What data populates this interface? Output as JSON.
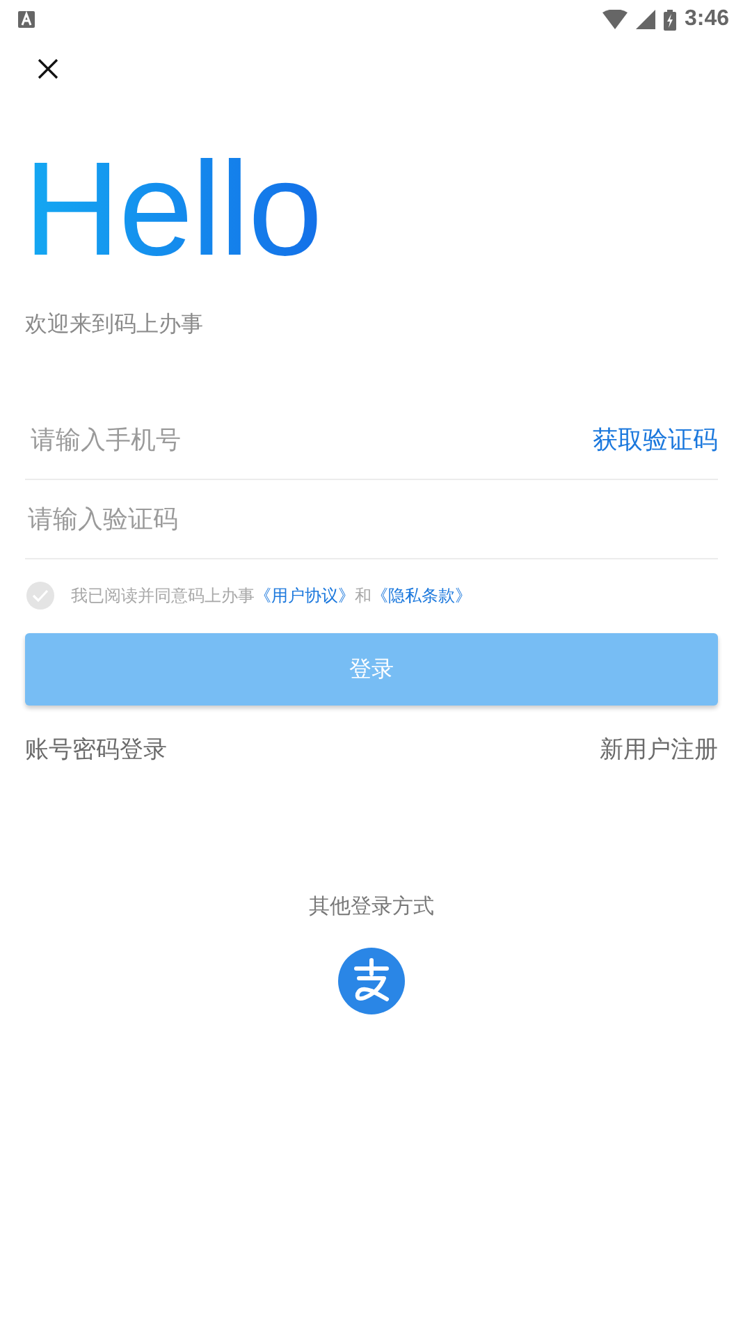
{
  "status_bar": {
    "time": "3:46"
  },
  "greeting": {
    "title": "Hello",
    "subtitle": "欢迎来到码上办事"
  },
  "phone_field": {
    "placeholder": "请输入手机号",
    "action": "获取验证码"
  },
  "code_field": {
    "placeholder": "请输入验证码"
  },
  "agreement": {
    "checked": false,
    "parts": [
      {
        "kind": "text",
        "text": "我已阅读并同意码上办事"
      },
      {
        "kind": "link",
        "text": "《用户协议》"
      },
      {
        "kind": "text",
        "text": "和"
      },
      {
        "kind": "link",
        "text": "《隐私条款》"
      }
    ]
  },
  "login_button": {
    "label": "登录",
    "disabled": true
  },
  "links": [
    {
      "label": "账号密码登录"
    },
    {
      "label": "新用户注册"
    }
  ],
  "other_login": {
    "label": "其他登录方式"
  }
}
